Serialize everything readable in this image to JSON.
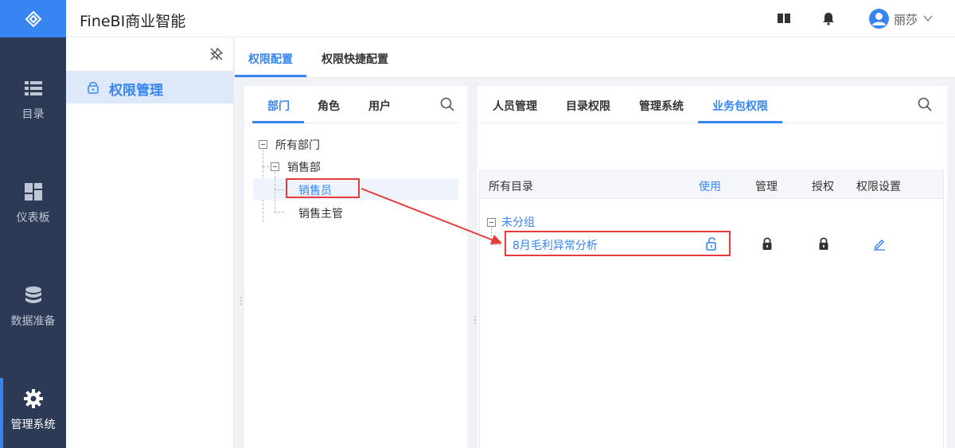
{
  "app": {
    "title": "FineBI商业智能"
  },
  "user": {
    "name": "丽莎"
  },
  "nav": {
    "items": [
      {
        "label": "目录",
        "icon": "list-icon"
      },
      {
        "label": "仪表板",
        "icon": "dashboard-icon"
      },
      {
        "label": "数据准备",
        "icon": "database-icon"
      },
      {
        "label": "管理系统",
        "icon": "gear-icon"
      }
    ]
  },
  "subside": {
    "item": "权限管理"
  },
  "tabs": {
    "items": [
      "权限配置",
      "权限快捷配置"
    ]
  },
  "left_panel": {
    "tabs": [
      "部门",
      "角色",
      "用户"
    ],
    "tree": [
      "所有部门",
      "销售部",
      "销售员",
      "销售主管"
    ]
  },
  "right_panel": {
    "tabs": [
      "人员管理",
      "目录权限",
      "管理系统",
      "业务包权限"
    ],
    "columns": [
      "所有目录",
      "使用",
      "管理",
      "授权",
      "权限设置"
    ],
    "group": "未分组",
    "row": "8月毛利异常分析"
  },
  "colors": {
    "accent": "#3685f2",
    "nav_bg": "#2c3a55",
    "highlight": "#e83a3a"
  }
}
